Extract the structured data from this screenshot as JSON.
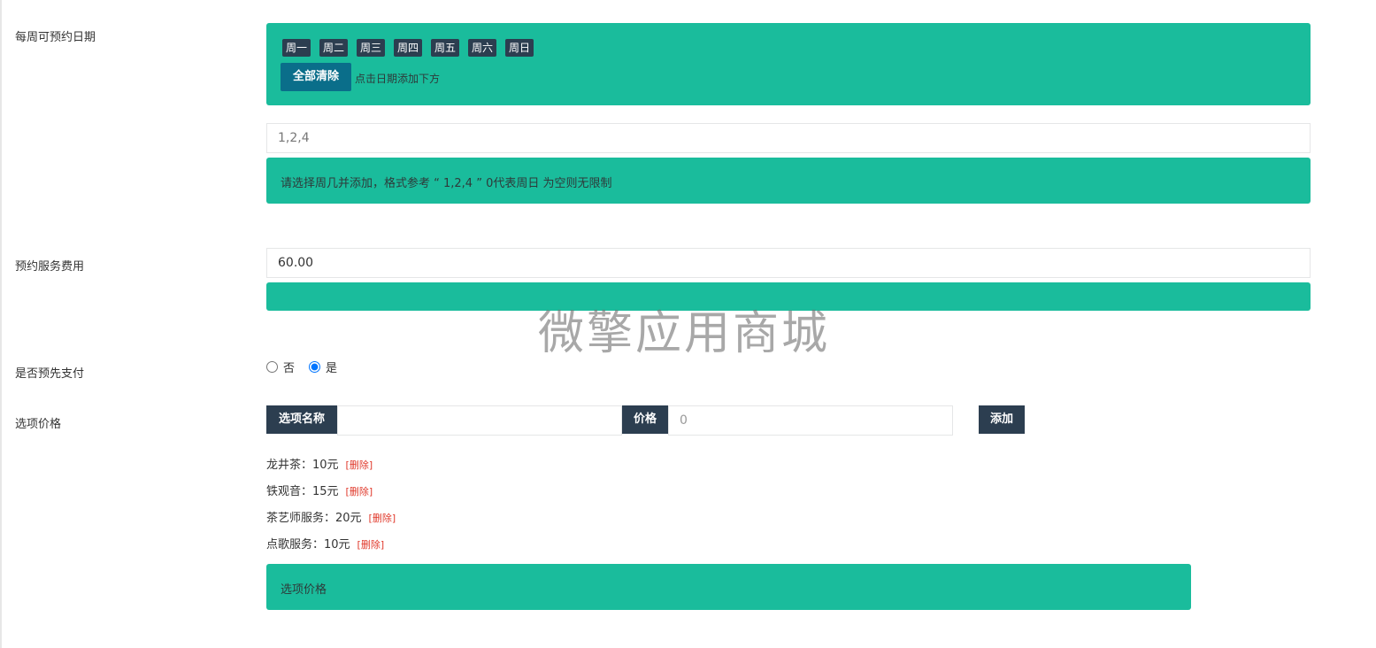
{
  "fields": {
    "weekdays": {
      "label": "每周可预约日期",
      "days": [
        "周一",
        "周二",
        "周三",
        "周四",
        "周五",
        "周六",
        "周日"
      ],
      "clear_label": "全部清除",
      "click_hint": "点击日期添加下方",
      "input_value": "1,2,4",
      "help_text": "请选择周几并添加，格式参考 “ 1,2,4 ” 0代表周日 为空则无限制"
    },
    "fee": {
      "label": "预约服务费用",
      "input_value": "60.00",
      "help_text": ""
    },
    "prepay": {
      "label": "是否预先支付",
      "options": [
        "否",
        "是"
      ],
      "selected": "是"
    },
    "options_price": {
      "label": "选项价格",
      "name_addon": "选项名称",
      "name_value": "",
      "price_addon": "价格",
      "price_placeholder": "0",
      "add_label": "添加",
      "delete_label": "[删除]",
      "items": [
        {
          "text": "龙井茶：10元"
        },
        {
          "text": "铁观音：15元"
        },
        {
          "text": "茶艺师服务：20元"
        },
        {
          "text": "点歌服务：10元"
        }
      ],
      "help_text": "选项价格"
    }
  },
  "watermark": "微擎应用商城",
  "colors": {
    "accent_green": "#1abc9c",
    "dark_button": "#2c3e50",
    "clear_button": "#0a6e8a",
    "delete_red": "#e0392b"
  }
}
